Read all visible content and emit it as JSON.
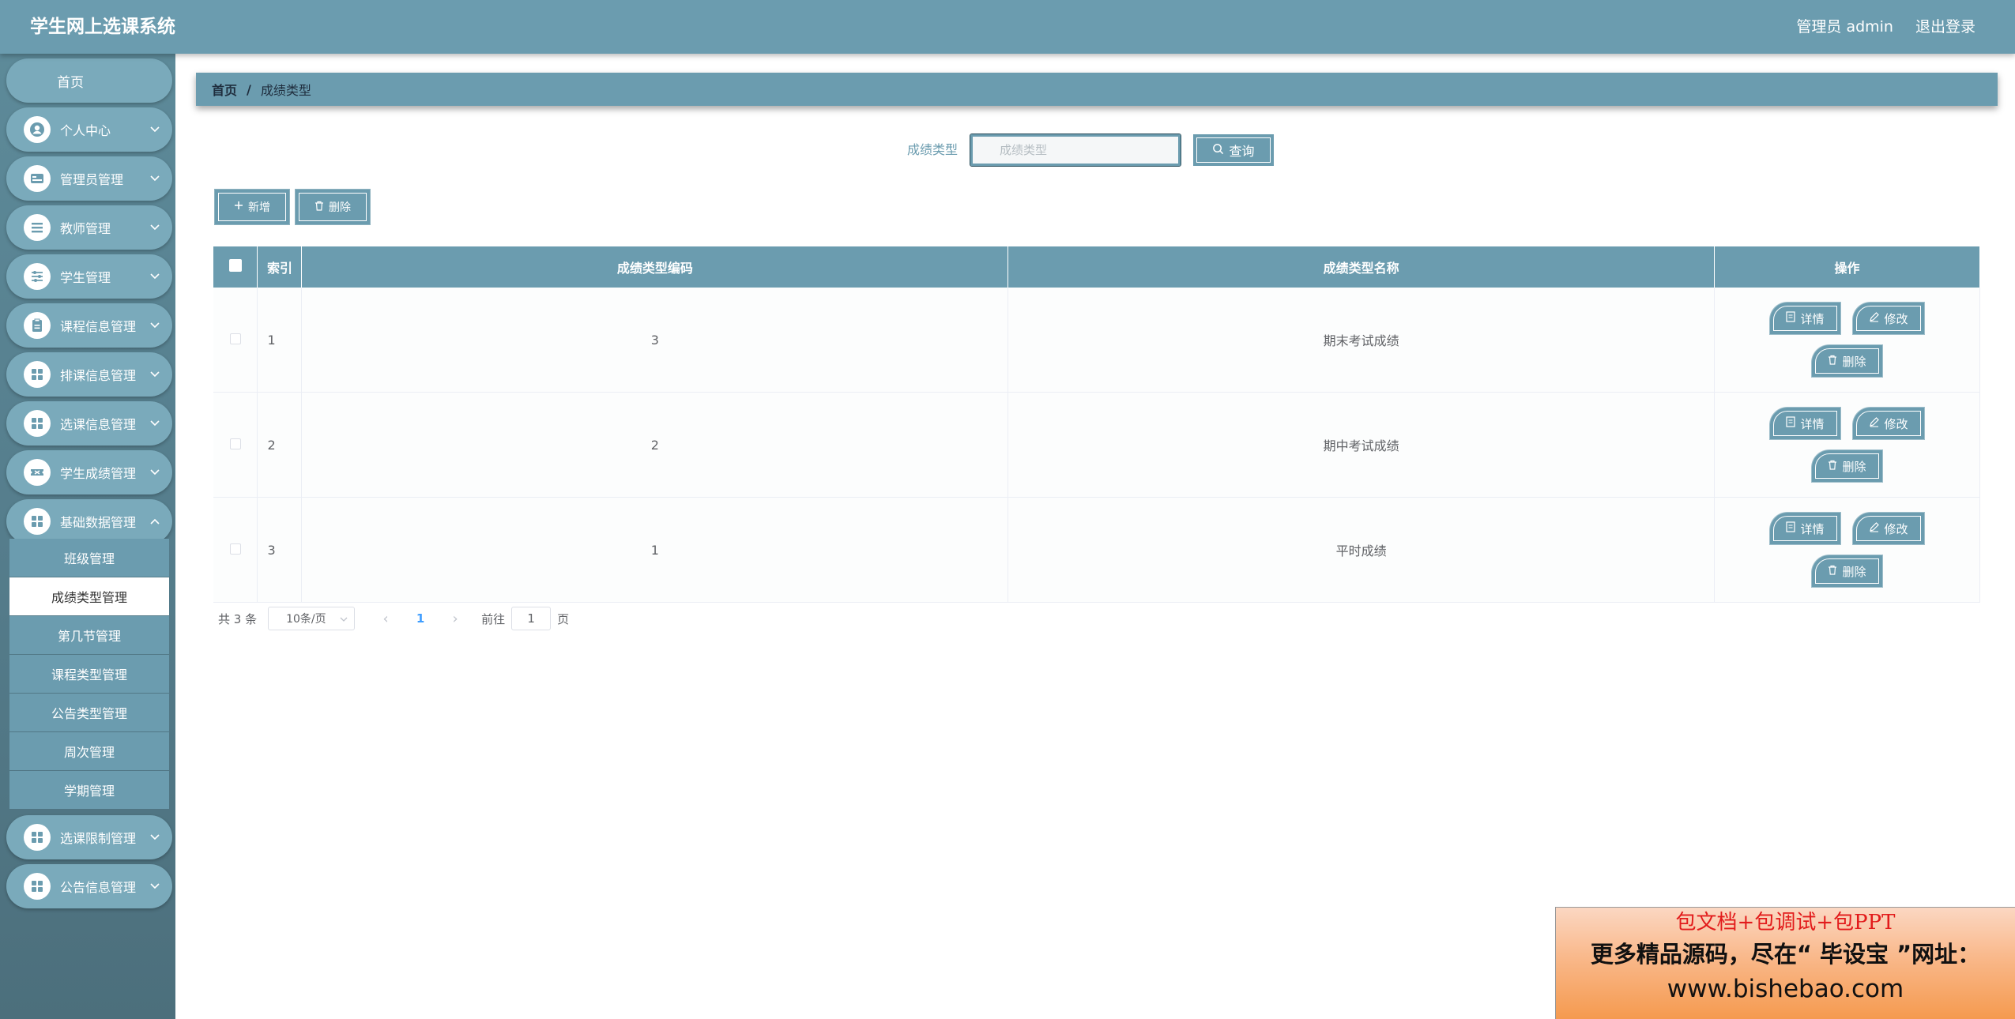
{
  "header": {
    "title": "学生网上选课系统",
    "user": "管理员 admin",
    "logout": "退出登录"
  },
  "sidebar": {
    "home": "首页",
    "items": [
      {
        "label": "个人中心",
        "icon": "user-icon"
      },
      {
        "label": "管理员管理",
        "icon": "card-icon"
      },
      {
        "label": "教师管理",
        "icon": "list-icon"
      },
      {
        "label": "学生管理",
        "icon": "sliders-icon"
      },
      {
        "label": "课程信息管理",
        "icon": "clipboard-icon"
      },
      {
        "label": "排课信息管理",
        "icon": "grid-icon"
      },
      {
        "label": "选课信息管理",
        "icon": "grid-icon"
      },
      {
        "label": "学生成绩管理",
        "icon": "ticket-icon"
      },
      {
        "label": "基础数据管理",
        "icon": "grid-icon"
      },
      {
        "label": "选课限制管理",
        "icon": "grid-icon"
      },
      {
        "label": "公告信息管理",
        "icon": "grid-icon"
      }
    ],
    "submenu": [
      {
        "label": "班级管理"
      },
      {
        "label": "成绩类型管理"
      },
      {
        "label": "第几节管理"
      },
      {
        "label": "课程类型管理"
      },
      {
        "label": "公告类型管理"
      },
      {
        "label": "周次管理"
      },
      {
        "label": "学期管理"
      }
    ]
  },
  "breadcrumb": {
    "home": "首页",
    "separator": "/",
    "current": "成绩类型"
  },
  "search": {
    "label": "成绩类型",
    "placeholder": "成绩类型",
    "button": "查询"
  },
  "toolbar": {
    "add": "新增",
    "delete": "删除"
  },
  "table": {
    "headers": [
      "索引",
      "成绩类型编码",
      "成绩类型名称",
      "操作"
    ],
    "rows": [
      {
        "index": "1",
        "code": "3",
        "name": "期末考试成绩"
      },
      {
        "index": "2",
        "code": "2",
        "name": "期中考试成绩"
      },
      {
        "index": "3",
        "code": "1",
        "name": "平时成绩"
      }
    ],
    "actions": {
      "detail": "详情",
      "edit": "修改",
      "delete": "删除"
    }
  },
  "pagination": {
    "total": "共 3 条",
    "page_size": "10条/页",
    "current_page": "1",
    "goto_prefix": "前往",
    "goto_value": "1",
    "goto_suffix": "页"
  },
  "promo": {
    "line1": "包文档+包调试+包PPT",
    "line2": "更多精品源码，尽在“ 毕设宝 ”网址：",
    "line3": "www.bishebao.com"
  },
  "colors": {
    "primary": "#6b9caf",
    "sidebar": "#557d8c",
    "active_page": "#409eff"
  }
}
